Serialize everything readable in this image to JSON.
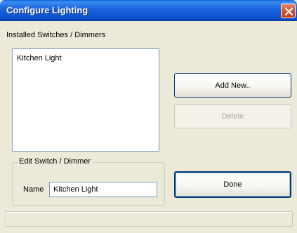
{
  "window": {
    "title": "Configure Lighting"
  },
  "switches": {
    "section_label": "Installed Switches / Dimmers",
    "items": [
      "Kitchen Light"
    ]
  },
  "buttons": {
    "add_new": "Add New..",
    "delete": "Delete",
    "done": "Done"
  },
  "edit": {
    "group_label": "Edit Switch / Dimmer",
    "name_label": "Name",
    "name_value": "Kitchen Light"
  },
  "colors": {
    "titlebar": "#0a4fc9",
    "window_bg": "#ece9d8",
    "close_button": "#d8522c",
    "field_border": "#7f9db9"
  },
  "icons": {
    "close": "close-x-icon"
  }
}
